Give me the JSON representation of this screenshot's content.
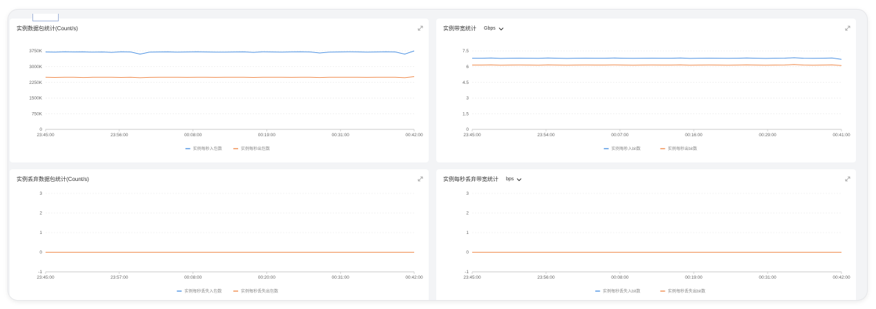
{
  "colors": {
    "series_in": "#4a90e2",
    "series_out": "#f08a4b",
    "grid": "#e7e7e7",
    "axis": "#b8b8b8"
  },
  "panels": [
    {
      "title": "实例数据包统计(Count/s)",
      "unit": ""
    },
    {
      "title": "实例带宽统计",
      "unit": "Gbps"
    },
    {
      "title": "实例丢弃数据包统计(Count/s)",
      "unit": ""
    },
    {
      "title": "实例每秒丢弃带宽统计",
      "unit": "bps"
    }
  ],
  "icons": {
    "expand": "expand-icon",
    "dropdown": "chevron-down-icon"
  },
  "chart_data": [
    {
      "type": "line",
      "ylim": [
        0,
        3750
      ],
      "yticks": [
        "0",
        "750K",
        "1500K",
        "2250K",
        "3000K",
        "3750K"
      ],
      "xticks": [
        "23:45:00",
        "23:56:00",
        "00:08:00",
        "00:19:00",
        "00:31:00",
        "00:42:00"
      ],
      "series": [
        {
          "name": "实例每秒入包数",
          "values": [
            3700,
            3690,
            3710,
            3700,
            3705,
            3690,
            3700,
            3680,
            3710,
            3700,
            3600,
            3690,
            3700,
            3705,
            3690,
            3700,
            3710,
            3700,
            3695,
            3690,
            3700,
            3705,
            3680,
            3710,
            3700,
            3690,
            3705,
            3710,
            3700,
            3650,
            3690,
            3700,
            3710,
            3705,
            3690,
            3700,
            3710,
            3700,
            3600,
            3750
          ]
        },
        {
          "name": "实例每秒出包数",
          "values": [
            2490,
            2485,
            2495,
            2490,
            2480,
            2490,
            2495,
            2490,
            2485,
            2490,
            2470,
            2488,
            2490,
            2495,
            2490,
            2488,
            2492,
            2490,
            2487,
            2490,
            2492,
            2490,
            2485,
            2490,
            2495,
            2490,
            2488,
            2492,
            2490,
            2480,
            2490,
            2492,
            2495,
            2490,
            2488,
            2490,
            2492,
            2490,
            2470,
            2520
          ]
        }
      ]
    },
    {
      "type": "line",
      "ylim": [
        0,
        7.5
      ],
      "yticks": [
        "0",
        "1.5",
        "3",
        "4.5",
        "6",
        "7.5"
      ],
      "xticks": [
        "23:45:00",
        "23:54:00",
        "00:07:00",
        "00:16:00",
        "00:29:00",
        "00:41:00"
      ],
      "series": [
        {
          "name": "实例每秒入bit数",
          "values": [
            6.8,
            6.8,
            6.82,
            6.78,
            6.8,
            6.81,
            6.8,
            6.79,
            6.82,
            6.8,
            6.78,
            6.8,
            6.81,
            6.8,
            6.8,
            6.82,
            6.8,
            6.79,
            6.8,
            6.81,
            6.8,
            6.8,
            6.82,
            6.78,
            6.8,
            6.81,
            6.8,
            6.79,
            6.8,
            6.82,
            6.8,
            6.78,
            6.8,
            6.81,
            6.85,
            6.8,
            6.79,
            6.8,
            6.82,
            6.7
          ]
        },
        {
          "name": "实例每秒出bit数",
          "values": [
            6.15,
            6.15,
            6.17,
            6.13,
            6.15,
            6.16,
            6.15,
            6.14,
            6.17,
            6.15,
            6.13,
            6.15,
            6.16,
            6.15,
            6.15,
            6.17,
            6.15,
            6.14,
            6.15,
            6.16,
            6.15,
            6.15,
            6.17,
            6.13,
            6.15,
            6.16,
            6.15,
            6.14,
            6.15,
            6.17,
            6.15,
            6.13,
            6.15,
            6.16,
            6.2,
            6.15,
            6.14,
            6.15,
            6.17,
            6.1
          ]
        }
      ]
    },
    {
      "type": "line",
      "ylim": [
        -1,
        3
      ],
      "yticks": [
        "-1",
        "0",
        "1",
        "2",
        "3"
      ],
      "xticks": [
        "23:45:00",
        "23:57:00",
        "00:08:00",
        "00:20:00",
        "00:31:00",
        "00:42:00"
      ],
      "series": [
        {
          "name": "实例每秒丢失入包数",
          "values": [
            0,
            0,
            0,
            0,
            0,
            0,
            0,
            0,
            0,
            0
          ]
        },
        {
          "name": "实例每秒丢失出包数",
          "values": [
            0,
            0,
            0,
            0,
            0,
            0,
            0,
            0,
            0,
            0
          ]
        }
      ]
    },
    {
      "type": "line",
      "ylim": [
        -1,
        3
      ],
      "yticks": [
        "-1",
        "0",
        "1",
        "2",
        "3"
      ],
      "xticks": [
        "23:45:00",
        "23:56:00",
        "00:08:00",
        "00:19:00",
        "00:31:00",
        "00:42:00"
      ],
      "series": [
        {
          "name": "实例每秒丢失入bit数",
          "values": [
            0,
            0,
            0,
            0,
            0,
            0,
            0,
            0,
            0,
            0
          ]
        },
        {
          "name": "实例每秒丢失出bit数",
          "values": [
            0,
            0,
            0,
            0,
            0,
            0,
            0,
            0,
            0,
            0
          ]
        }
      ]
    }
  ]
}
